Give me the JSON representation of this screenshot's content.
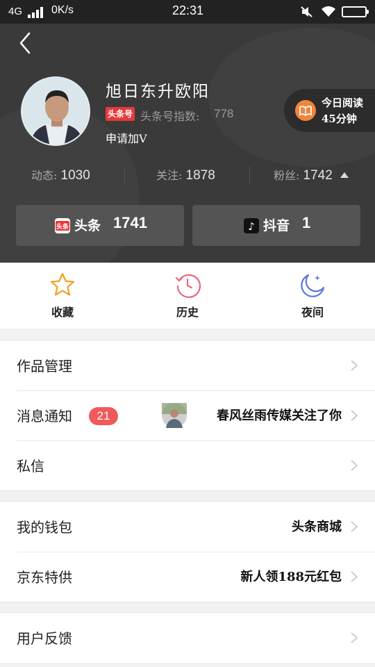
{
  "status_bar": {
    "network": "4G",
    "speed": "0K/s",
    "time": "22:31"
  },
  "profile": {
    "name": "旭日东升欧阳",
    "badge": "头条号",
    "index_label": "头条号指数:",
    "index_value": "778",
    "apply_v": "申请加V",
    "reading_line1": "今日阅读",
    "reading_line2": "45分钟"
  },
  "stats": [
    {
      "label": "动态:",
      "value": "1030"
    },
    {
      "label": "关注:",
      "value": "1878"
    },
    {
      "label": "粉丝:",
      "value": "1742"
    }
  ],
  "platforms": [
    {
      "name": "头条",
      "count": "1741",
      "icon": "toutiao-icon",
      "icon_text": "头条"
    },
    {
      "name": "抖音",
      "count": "1",
      "icon": "douyin-icon",
      "icon_text": "♪"
    }
  ],
  "quick_actions": [
    {
      "label": "收藏",
      "icon": "star-icon"
    },
    {
      "label": "历史",
      "icon": "history-icon"
    },
    {
      "label": "夜间",
      "icon": "moon-icon"
    }
  ],
  "menu": {
    "works": "作品管理",
    "notifications": "消息通知",
    "notification_count": "21",
    "notification_text": "春风丝雨传媒关注了你",
    "private_message": "私信",
    "wallet": "我的钱包",
    "wallet_sub": "头条商城",
    "jd": "京东特供",
    "jd_sub": "新人领188元红包",
    "feedback": "用户反馈"
  },
  "colors": {
    "header_bg": "#3a3a3a",
    "accent_red": "#e8393a",
    "badge_red": "#f05a5a",
    "star_orange": "#f0a020",
    "history_pink": "#e8667a",
    "moon_blue": "#5a78d8"
  }
}
